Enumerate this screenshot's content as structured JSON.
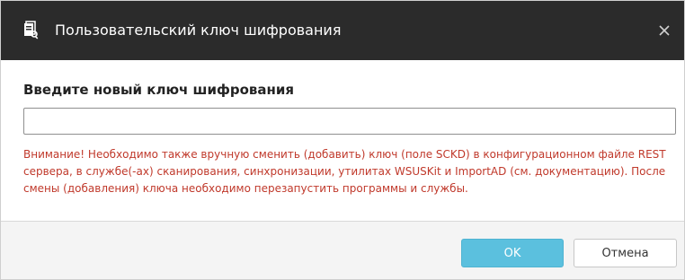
{
  "window": {
    "title": "Пользовательский ключ шифрования",
    "title_icon": "document-key-icon",
    "close_icon": "close-icon",
    "titlebar_color": "#2b2b2b"
  },
  "form": {
    "heading": "Введите новый ключ шифрования",
    "input_value": "",
    "input_placeholder": "",
    "warning": "Внимание! Необходимо также вручную сменить (добавить) ключ (поле SCKD) в конфигурационном файле REST сервера, в службе(-ах) сканирования, синхронизации, утилитах WSUSKit и ImportAD (см. документацию). После смены (добавления) ключа необходимо перезапустить программы и службы.",
    "warning_color": "#c0392b"
  },
  "footer": {
    "ok_label": "OK",
    "cancel_label": "Отмена",
    "ok_color": "#5bc0de"
  }
}
